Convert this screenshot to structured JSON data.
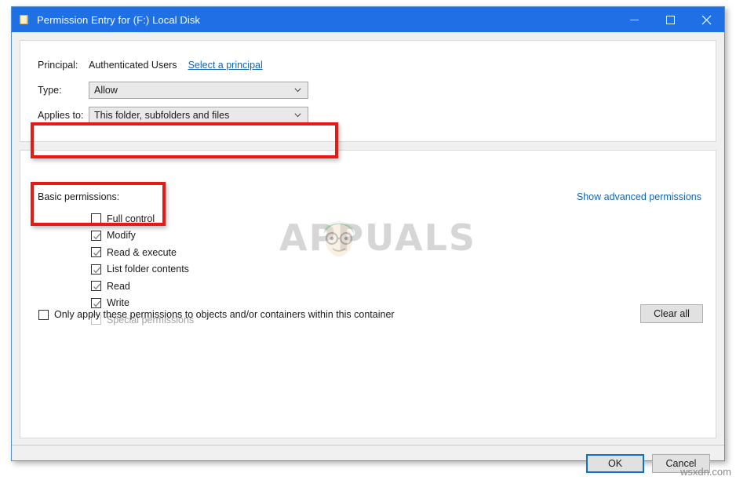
{
  "window": {
    "title": "Permission Entry for (F:) Local Disk",
    "icon": "folder-icon",
    "minimize_label": "Minimize",
    "maximize_label": "Maximize",
    "close_label": "Close",
    "title_bar_color": "#1f6fe5",
    "border_color": "#5b8fc9"
  },
  "top_section": {
    "principal": {
      "label": "Principal:",
      "value": "Authenticated Users",
      "link": "Select a principal"
    },
    "type": {
      "label": "Type:",
      "value": "Allow"
    },
    "applies_to": {
      "label": "Applies to:",
      "value": "This folder, subfolders and files"
    }
  },
  "permissions_section": {
    "basic_label": "Basic permissions:",
    "advanced_link": "Show advanced permissions",
    "items": [
      {
        "label": "Full control",
        "checked": false,
        "disabled": false
      },
      {
        "label": "Modify",
        "checked": true,
        "disabled": false
      },
      {
        "label": "Read & execute",
        "checked": true,
        "disabled": false
      },
      {
        "label": "List folder contents",
        "checked": true,
        "disabled": false
      },
      {
        "label": "Read",
        "checked": true,
        "disabled": false
      },
      {
        "label": "Write",
        "checked": true,
        "disabled": false
      },
      {
        "label": "Special permissions",
        "checked": false,
        "disabled": true
      }
    ],
    "only_apply": {
      "label": "Only apply these permissions to objects and/or containers within this container",
      "checked": false
    },
    "clear_all_label": "Clear all"
  },
  "footer": {
    "ok_label": "OK",
    "cancel_label": "Cancel"
  },
  "annotations": {
    "highlight_color": "#e51b13",
    "boxes": [
      "applies-to-row",
      "basic-permissions-full-control"
    ]
  },
  "watermarks": {
    "brand": "APPUALS",
    "site": "wsxdn.com"
  }
}
